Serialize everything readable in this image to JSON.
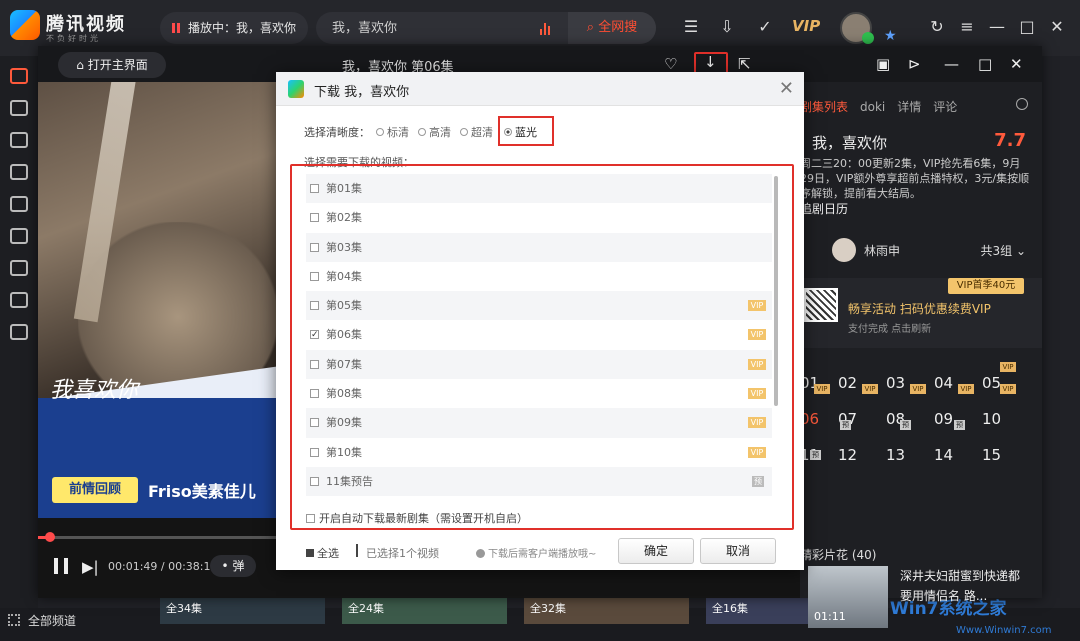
{
  "app": {
    "brand": "腾讯视频",
    "slogan": "不负好时光"
  },
  "topbar": {
    "playing_label": "播放中：我，喜欢你",
    "search_placeholder": "我，喜欢你",
    "search_button": "全网搜",
    "vip_label": "VIP"
  },
  "player": {
    "home_button": "打开主界面",
    "title": "我，喜欢你 第06集",
    "time": "00:01:49 / 00:38:14",
    "danmu": "弹",
    "progress": 0.05,
    "ad_title": "我喜欢你",
    "ad_tag": "前情回顾",
    "ad_brand": "Friso美素佳儿"
  },
  "panel": {
    "tabs": [
      "剧集列表",
      "doki",
      "详情",
      "评论"
    ],
    "show_title": "我，喜欢你",
    "score": "7.7",
    "desc": "周二三20：00更新2集，VIP抢先看6集，9月29日，VIP额外尊享超前点播特权，3元/集按顺序解锁，提前看大结局。",
    "calendar": "追剧日历",
    "actor": "林雨申",
    "groups": "共3组",
    "vip_tag": "VIP首季40元",
    "promo_title": "畅享活动 扫码优惠续费VIP",
    "promo_sub": "支付完成 点击刷新",
    "episodes_row1": [
      "01",
      "02",
      "03",
      "04",
      "05"
    ],
    "episodes_row2": [
      "06",
      "07",
      "08",
      "09",
      "10"
    ],
    "episodes_row3": [
      "11",
      "12",
      "13",
      "14",
      "15"
    ],
    "badge_vip": "VIP",
    "badge_preview": "预",
    "clips_label": "精彩片花 (40)",
    "clip_time": "01:11",
    "clip_title": "深井夫妇甜蜜到快递都要用情侣名 路..."
  },
  "dialog": {
    "title": "下载 我，喜欢你",
    "quality_label": "选择清晰度：",
    "qualities": [
      "标清",
      "高清",
      "超清",
      "蓝光"
    ],
    "selected_quality": "蓝光",
    "select_label": "选择需要下载的视频：",
    "episodes": [
      {
        "label": "第01集",
        "checked": false,
        "badge": ""
      },
      {
        "label": "第02集",
        "checked": false,
        "badge": ""
      },
      {
        "label": "第03集",
        "checked": false,
        "badge": ""
      },
      {
        "label": "第04集",
        "checked": false,
        "badge": ""
      },
      {
        "label": "第05集",
        "checked": false,
        "badge": "VIP"
      },
      {
        "label": "第06集",
        "checked": true,
        "badge": "VIP"
      },
      {
        "label": "第07集",
        "checked": false,
        "badge": "VIP"
      },
      {
        "label": "第08集",
        "checked": false,
        "badge": "VIP"
      },
      {
        "label": "第09集",
        "checked": false,
        "badge": "VIP"
      },
      {
        "label": "第10集",
        "checked": false,
        "badge": "VIP"
      },
      {
        "label": "11集预告",
        "checked": false,
        "badge": "预"
      }
    ],
    "auto_download": "开启自动下载最新剧集（需设置开机自启）",
    "select_all": "全选",
    "selected_count": "已选择1个视频",
    "hint": "下载后需客户端播放哦~",
    "confirm": "确定",
    "cancel": "取消"
  },
  "bottom": {
    "all_channels": "全部频道",
    "thumbs": [
      "全34集",
      "全24集",
      "全32集",
      "全16集"
    ],
    "watermark": "Win7系统之家",
    "watermark_url": "Www.Winwin7.com"
  }
}
